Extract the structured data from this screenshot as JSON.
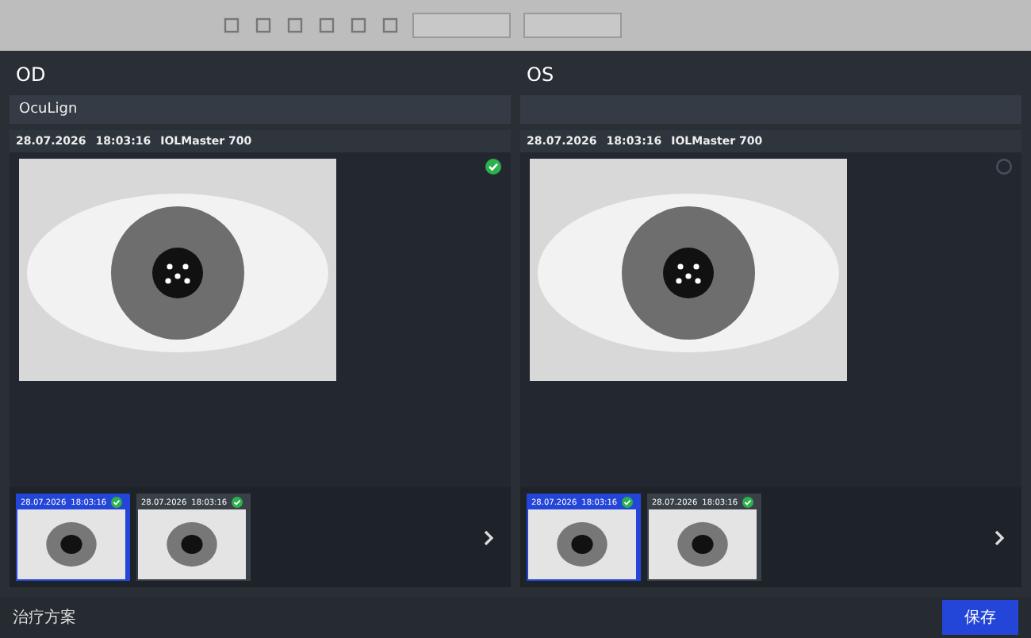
{
  "panels": [
    {
      "eye": "OD",
      "subtitle": "OcuLign",
      "header": [
        "28.07.2026",
        "18:03:16",
        "IOLMaster 700"
      ],
      "verified": true,
      "thumbnails": [
        {
          "date": "28.07.2026",
          "time": "18:03:16",
          "selected": true,
          "verified": true
        },
        {
          "date": "28.07.2026",
          "time": "18:03:16",
          "selected": false,
          "verified": true
        }
      ]
    },
    {
      "eye": "OS",
      "header": [
        "28.07.2026",
        "18:03:16",
        "IOLMaster 700"
      ],
      "verified": false,
      "thumbnails": [
        {
          "date": "28.07.2026",
          "time": "18:03:16",
          "selected": true,
          "verified": true
        },
        {
          "date": "28.07.2026",
          "time": "18:03:16",
          "selected": false,
          "verified": true
        }
      ]
    }
  ],
  "footer": {
    "label": "治疗方案",
    "button": "保存"
  }
}
